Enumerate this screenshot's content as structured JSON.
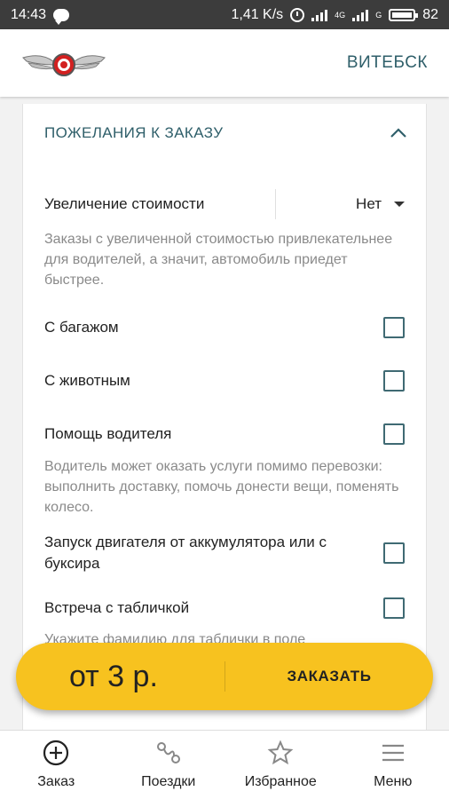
{
  "status_bar": {
    "time": "14:43",
    "speed": "1,41 K/s",
    "network1": "4G",
    "network2": "G",
    "battery": "82"
  },
  "header": {
    "city": "ВИТЕБСК"
  },
  "section": {
    "title": "ПОЖЕЛАНИЯ К ЗАКАЗУ",
    "price_increase": {
      "label": "Увеличение стоимости",
      "value": "Нет"
    },
    "price_hint": "Заказы с увеличенной стоимостью привлекательнее для водителей, а значит, автомобиль приедет быстрее.",
    "options": [
      {
        "label": "С багажом",
        "checked": false
      },
      {
        "label": "С животным",
        "checked": false
      },
      {
        "label": "Помощь водителя",
        "checked": false
      },
      {
        "label": "Запуск двигателя от аккумулятора или с буксира",
        "checked": false
      },
      {
        "label": "Встреча с табличкой",
        "checked": false
      }
    ],
    "driver_help_hint": "Водитель может оказать услуги помимо перевозки: выполнить доставку, помочь донести вещи, поменять колесо.",
    "sign_hint": "Укажите фамилию для таблички в поле"
  },
  "order": {
    "price": "от 3 р.",
    "button": "ЗАКАЗАТЬ"
  },
  "tabs": [
    {
      "label": "Заказ",
      "icon": "plus-circle-icon"
    },
    {
      "label": "Поездки",
      "icon": "route-icon"
    },
    {
      "label": "Избранное",
      "icon": "star-icon"
    },
    {
      "label": "Меню",
      "icon": "menu-icon"
    }
  ],
  "colors": {
    "accent": "#2f5f6a",
    "order_bar": "#f7c21f",
    "checkbox_border": "#3f6a73",
    "hint_text": "#8a8a8a"
  }
}
